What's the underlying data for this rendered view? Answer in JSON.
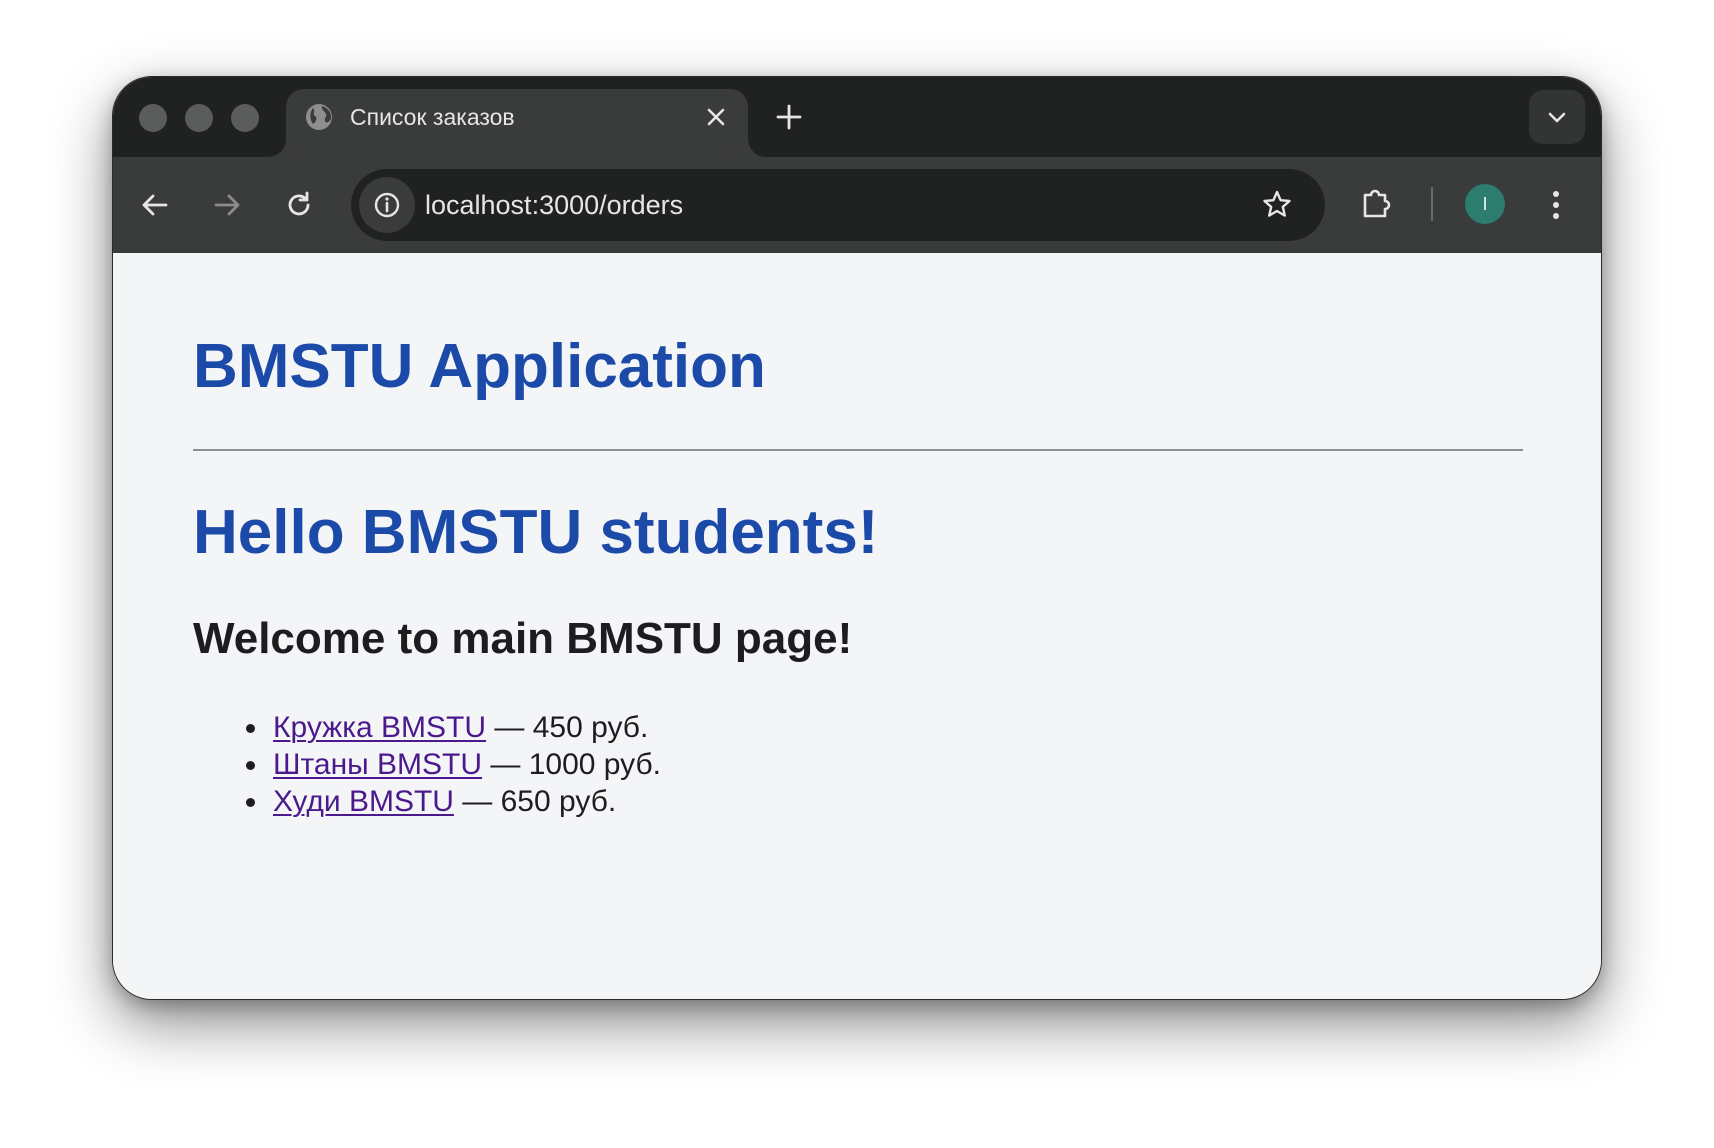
{
  "browser": {
    "tab": {
      "title": "Список заказов",
      "favicon": "globe-icon"
    },
    "url": "localhost:3000/orders",
    "profile_initial": "I",
    "colors": {
      "tabstrip": "#202221",
      "toolbar": "#3a3b3b",
      "omnibox": "#202221",
      "avatar": "#2d7d6f"
    }
  },
  "page": {
    "app_title": "BMSTU Application",
    "heading": "Hello BMSTU students!",
    "subheading": "Welcome to main BMSTU page!",
    "orders": [
      {
        "name": "Кружка BMSTU",
        "price_text": " — 450 руб."
      },
      {
        "name": "Штаны BMSTU",
        "price_text": " — 1000 руб."
      },
      {
        "name": "Худи BMSTU",
        "price_text": " — 650 руб."
      }
    ],
    "colors": {
      "heading": "#1c4aa8",
      "link_visited": "#4a1a8c",
      "text": "#1d1d1f",
      "background": "#f4f5f7"
    }
  }
}
